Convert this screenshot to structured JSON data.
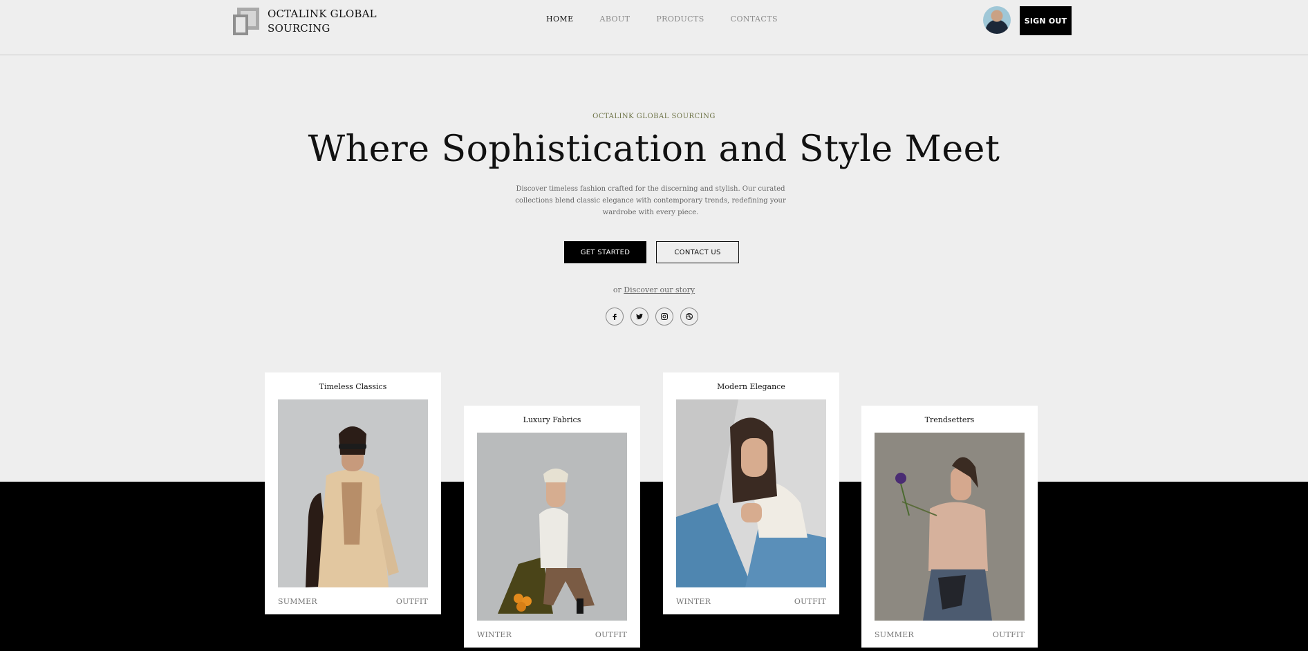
{
  "header": {
    "logo_line1": "OCTALINK GLOBAL",
    "logo_line2": "SOURCING",
    "nav": [
      "HOME",
      "ABOUT",
      "PRODUCTS",
      "CONTACTS"
    ],
    "sign_out": "SIGN OUT"
  },
  "hero": {
    "eyebrow": "OCTALINK GLOBAL SOURCING",
    "title": "Where Sophistication and Style Meet",
    "description": "Discover timeless fashion crafted for the discerning and stylish. Our curated collections blend classic elegance with contemporary trends, redefining your wardrobe with every piece.",
    "cta_primary": "GET STARTED",
    "cta_secondary": "CONTACT US",
    "story_prefix": "or",
    "story_link": "Discover our story"
  },
  "socials": [
    "facebook-icon",
    "twitter-icon",
    "instagram-icon",
    "dribbble-icon"
  ],
  "cards": [
    {
      "title": "Timeless Classics",
      "season": "SUMMER",
      "type": "OUTFIT"
    },
    {
      "title": "Luxury Fabrics",
      "season": "WINTER",
      "type": "OUTFIT"
    },
    {
      "title": "Modern Elegance",
      "season": "WINTER",
      "type": "OUTFIT"
    },
    {
      "title": "Trendsetters",
      "season": "SUMMER",
      "type": "OUTFIT"
    }
  ],
  "colors": {
    "background": "#eeeeee",
    "band": "#000000",
    "eyebrow": "#6d7346"
  }
}
